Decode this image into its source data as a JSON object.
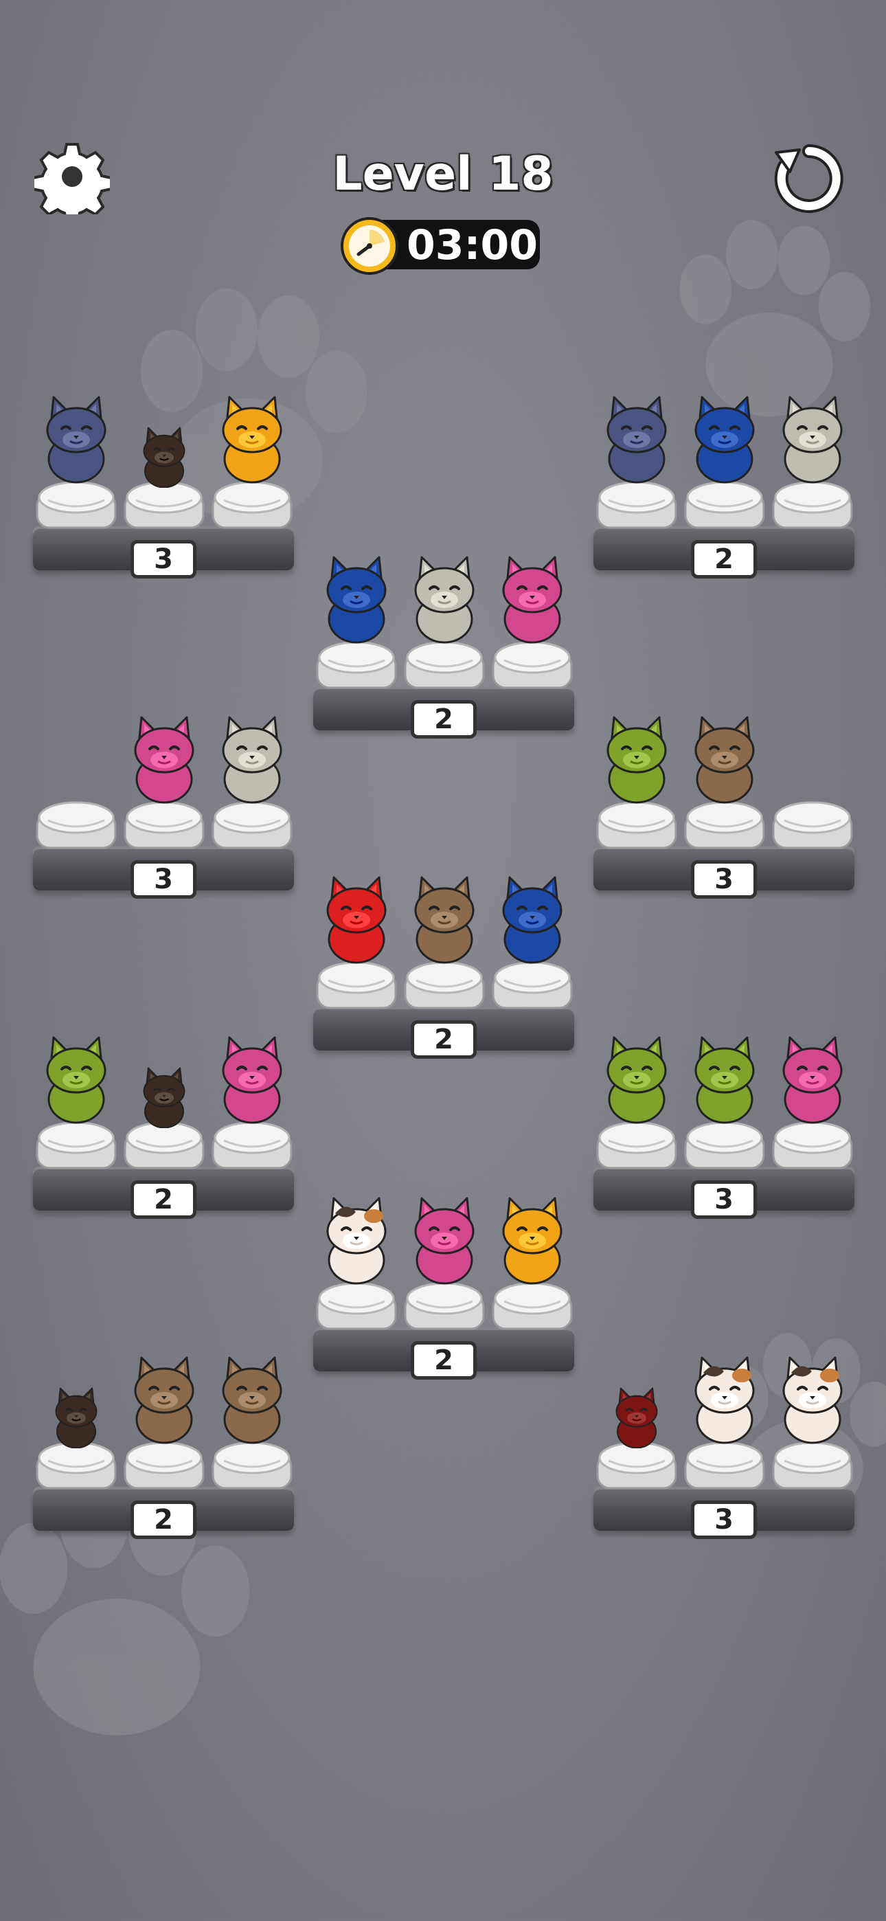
{
  "level": {
    "title": "Level 18"
  },
  "timer": {
    "value": "03:00"
  },
  "icons": {
    "settings": "gear-icon",
    "restart": "restart-icon",
    "timer": "stopwatch-icon"
  },
  "colors": {
    "navy": "#4a5583",
    "dark": "#3b2a22",
    "orange": "#f2a417",
    "blue": "#1d49a6",
    "gray": "#bfbcb2",
    "pink": "#d2478d",
    "green": "#7fa22a",
    "brown": "#8b6a4c",
    "red": "#dd1f1f",
    "calico": "#f6ebe3",
    "darkred": "#7c1414"
  },
  "shelves": [
    {
      "badge": "3",
      "slots": [
        "navy",
        "dark",
        "orange"
      ]
    },
    {
      "badge": "2",
      "slots": [
        "navy",
        "blue",
        "gray"
      ]
    },
    {
      "badge": "2",
      "slots": [
        "blue",
        "gray",
        "pink"
      ]
    },
    {
      "badge": "3",
      "slots": [
        "",
        "pink",
        "gray"
      ]
    },
    {
      "badge": "3",
      "slots": [
        "green",
        "brown",
        ""
      ]
    },
    {
      "badge": "2",
      "slots": [
        "red",
        "brown",
        "blue"
      ]
    },
    {
      "badge": "2",
      "slots": [
        "green",
        "dark",
        "pink"
      ]
    },
    {
      "badge": "3",
      "slots": [
        "green",
        "green",
        "pink"
      ]
    },
    {
      "badge": "2",
      "slots": [
        "calico",
        "pink",
        "orange"
      ]
    },
    {
      "badge": "2",
      "slots": [
        "dark",
        "brown",
        "brown"
      ]
    },
    {
      "badge": "3",
      "slots": [
        "darkred",
        "calico",
        "calico"
      ]
    }
  ]
}
